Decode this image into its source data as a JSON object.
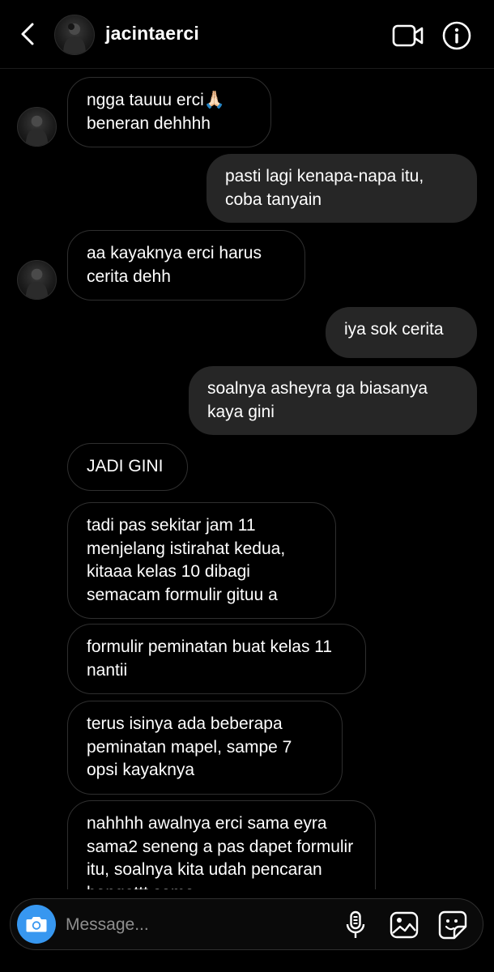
{
  "header": {
    "username": "jacintaerci",
    "icons": {
      "back": "back-chevron-icon",
      "avatar": "profile-avatar",
      "video": "video-call-icon",
      "info": "info-icon"
    }
  },
  "messages": [
    {
      "side": "in",
      "text": "ngga tauuu erci🙏🏻 beneran dehhhh",
      "avatar": true
    },
    {
      "side": "out",
      "text": "pasti lagi kenapa-napa itu, coba tanyain"
    },
    {
      "side": "in",
      "text": "aa kayaknya erci harus cerita dehh",
      "avatar": true
    },
    {
      "side": "out",
      "text": "iya sok cerita"
    },
    {
      "side": "out",
      "text": "soalnya asheyra ga biasanya kaya gini"
    },
    {
      "side": "in",
      "text": "JADI GINI"
    },
    {
      "side": "in",
      "text": "tadi pas sekitar jam 11 menjelang istirahat kedua, kitaaa kelas 10 dibagi semacam formulir gituu a"
    },
    {
      "side": "in",
      "text": "formulir peminatan buat kelas 11 nantii"
    },
    {
      "side": "in",
      "text": "terus isinya ada beberapa peminatan mapel, sampe 7 opsi kayaknya"
    },
    {
      "side": "in",
      "text": "nahhhh awalnya erci sama eyra sama2 seneng a pas dapet formulir itu, soalnya kita udah pencaran bangettt sama"
    }
  ],
  "composer": {
    "placeholder": "Message...",
    "icons": [
      "camera-icon",
      "microphone-icon",
      "gallery-icon",
      "sticker-icon"
    ],
    "camera_color": "#3797f0"
  },
  "colors": {
    "background": "#000000",
    "outgoing_bubble": "#262626",
    "incoming_border": "#2f2f2f",
    "placeholder": "#8e8e8e"
  }
}
